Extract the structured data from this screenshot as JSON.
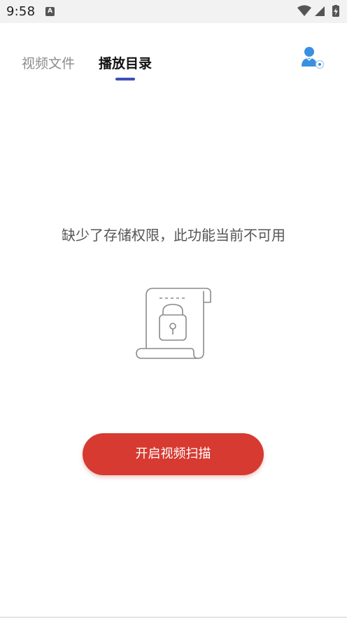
{
  "status_bar": {
    "time": "9:58",
    "notification_icon_text": "A",
    "icons": [
      "wifi-icon",
      "cell-signal-icon",
      "battery-charging-icon"
    ]
  },
  "tabs": [
    {
      "label": "视频文件",
      "active": false
    },
    {
      "label": "播放目录",
      "active": true
    }
  ],
  "header": {
    "avatar_icon": "user-settings-icon"
  },
  "empty_state": {
    "message": "缺少了存储权限，此功能当前不可用",
    "illustration": "locked-document-icon"
  },
  "action": {
    "scan_label": "开启视频扫描"
  },
  "colors": {
    "accent": "#3d4fb8",
    "primary_button": "#d63a31",
    "avatar_blue": "#3b8fe0"
  }
}
